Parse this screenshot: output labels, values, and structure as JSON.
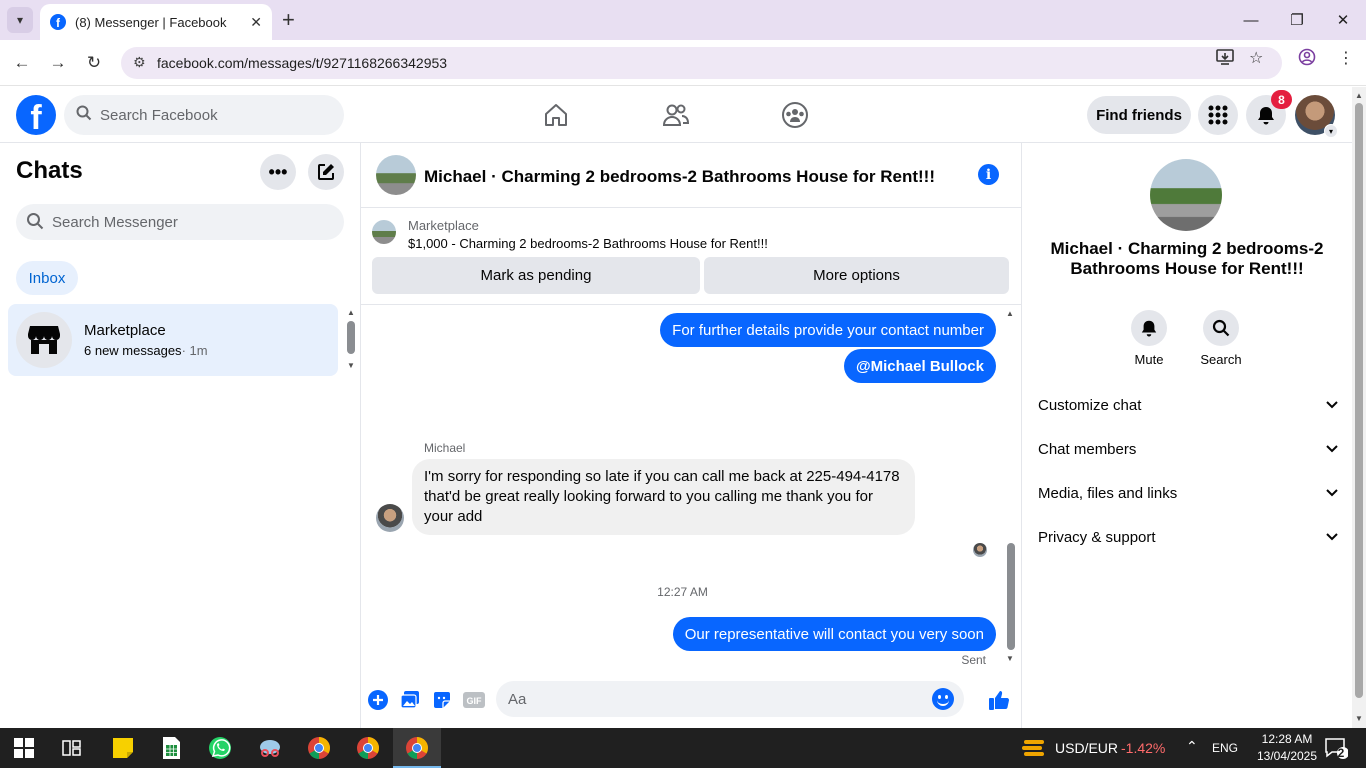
{
  "browser": {
    "tab_title": "(8) Messenger | Facebook",
    "url": "facebook.com/messages/t/9271168266342953"
  },
  "facebook": {
    "search_placeholder": "Search Facebook",
    "find_friends": "Find friends",
    "notification_count": "8"
  },
  "sidebar": {
    "title": "Chats",
    "search_placeholder": "Search Messenger",
    "filter_inbox": "Inbox",
    "chats": [
      {
        "name": "Marketplace",
        "preview": "6 new messages",
        "time": "· 1m"
      }
    ]
  },
  "conversation": {
    "title": "Michael · Charming 2 bedrooms-2 Bathrooms House for Rent!!!",
    "marketplace_label": "Marketplace",
    "listing": "$1,000 - Charming 2 bedrooms-2 Bathrooms House for Rent!!!",
    "mark_pending": "Mark as pending",
    "more_options": "More options",
    "messages": [
      {
        "text": "For further details provide your contact number"
      },
      {
        "text": "@Michael Bullock"
      },
      {
        "sender": "Michael",
        "text": "I'm sorry for responding so late if you can call me back at 225-494-4178 that'd be great really looking forward to you calling me thank you for your add"
      },
      {
        "timestamp": "12:27 AM"
      },
      {
        "text": "Our representative will contact you very soon",
        "status": "Sent"
      }
    ],
    "composer_placeholder": "Aa"
  },
  "details": {
    "name": "Michael · Charming 2 bedrooms-2 Bathrooms House for Rent!!!",
    "mute": "Mute",
    "search": "Search",
    "sections": [
      "Customize chat",
      "Chat members",
      "Media, files and links",
      "Privacy & support"
    ]
  },
  "taskbar": {
    "currency_pair": "USD/EUR",
    "currency_change": "-1.42%",
    "language": "ENG",
    "time": "12:28 AM",
    "date": "13/04/2025",
    "notifications": "2"
  },
  "colors": {
    "accent": "#0866ff",
    "negative": "#ff6b6b"
  }
}
